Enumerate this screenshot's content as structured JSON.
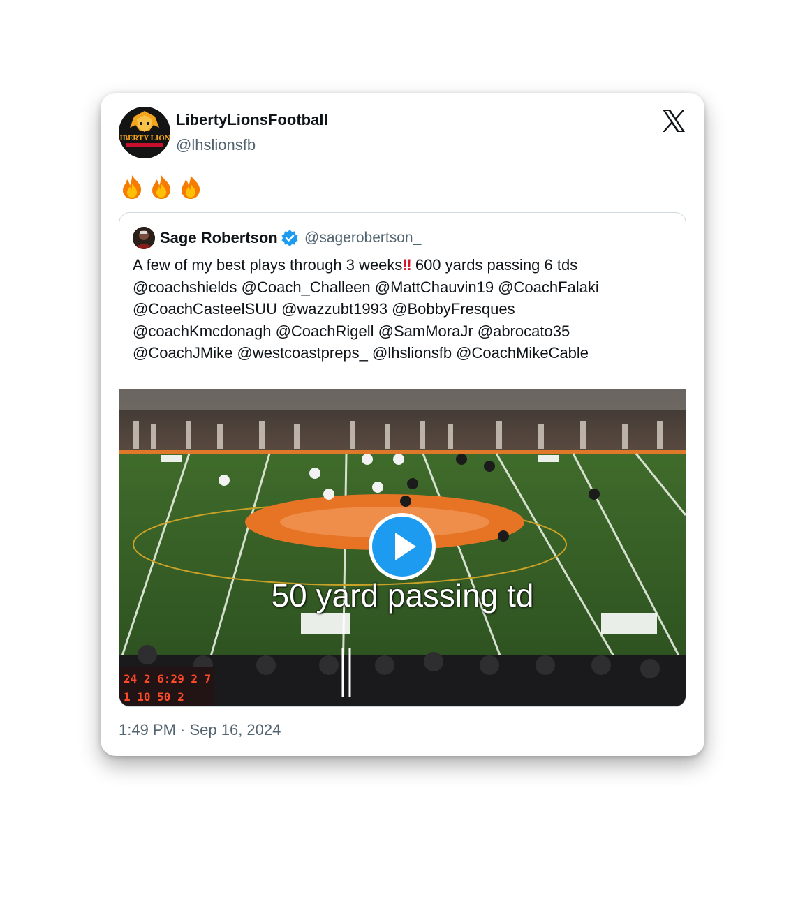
{
  "tweet": {
    "author_name": "LibertyLionsFootball",
    "author_handle": "@lhslionsfb",
    "avatar_icon": "liberty-lions-logo",
    "avatar_text": "LIBERTY LIONS",
    "body_emoji": [
      "fire",
      "fire",
      "fire"
    ],
    "timestamp": "1:49 PM · Sep 16, 2024"
  },
  "quoted": {
    "author_name": "Sage Robertson",
    "author_handle": "@sagerobertson_",
    "verified": true,
    "text_lines": [
      {
        "before": "A few of my best plays through 3 weeks",
        "emoji": "‼",
        "after": " 600 yards passing 6 tds"
      },
      {
        "text": "@coachshields @Coach_Challeen @MattChauvin19 @CoachFalaki"
      },
      {
        "text": "@CoachCasteelSUU @wazzubt1993 @BobbyFresques"
      },
      {
        "text": "@coachKmcdonagh @CoachRigell @SamMoraJr @abrocato35"
      },
      {
        "text": "@CoachJMike @westcoastpreps_ @lhslionsfb @CoachMikeCable"
      }
    ],
    "video": {
      "caption": "50 yard passing td",
      "scoreboard": {
        "top": "24 2 6:29 2 7",
        "bottom": "1 10 50 2"
      }
    }
  },
  "colors": {
    "verified_blue": "#1d9bf0",
    "play_button": "#1d9bf0",
    "handle_gray": "#536471"
  }
}
